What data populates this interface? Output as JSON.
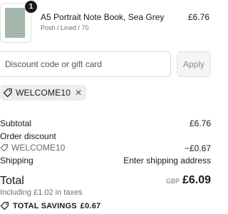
{
  "product": {
    "name": "A5 Portrait Note Book, Sea Grey",
    "variant": "Posh / Lined / 70",
    "price": "£6.76",
    "quantity": "1"
  },
  "discount": {
    "placeholder": "Discount code or gift card",
    "apply_label": "Apply",
    "applied_code": "WELCOME10",
    "remove_symbol": "✕"
  },
  "summary": {
    "subtotal_label": "Subtotal",
    "subtotal_value": "£6.76",
    "order_discount_label": "Order discount",
    "discount_code": "WELCOME10",
    "discount_value": "−£0.67",
    "shipping_label": "Shipping",
    "shipping_value": "Enter shipping address",
    "total_label": "Total",
    "currency": "GBP",
    "total_value": "£6.09",
    "taxes_note": "Including £1.02 in taxes",
    "savings_label": "TOTAL SAVINGS",
    "savings_value": "£0.67"
  },
  "colors": {
    "text": "#1a1a1a",
    "muted": "#707070",
    "badge": "#1b1b1b",
    "notebook": "#9fb3a6"
  },
  "icons": [
    "tag-icon",
    "close-icon"
  ]
}
